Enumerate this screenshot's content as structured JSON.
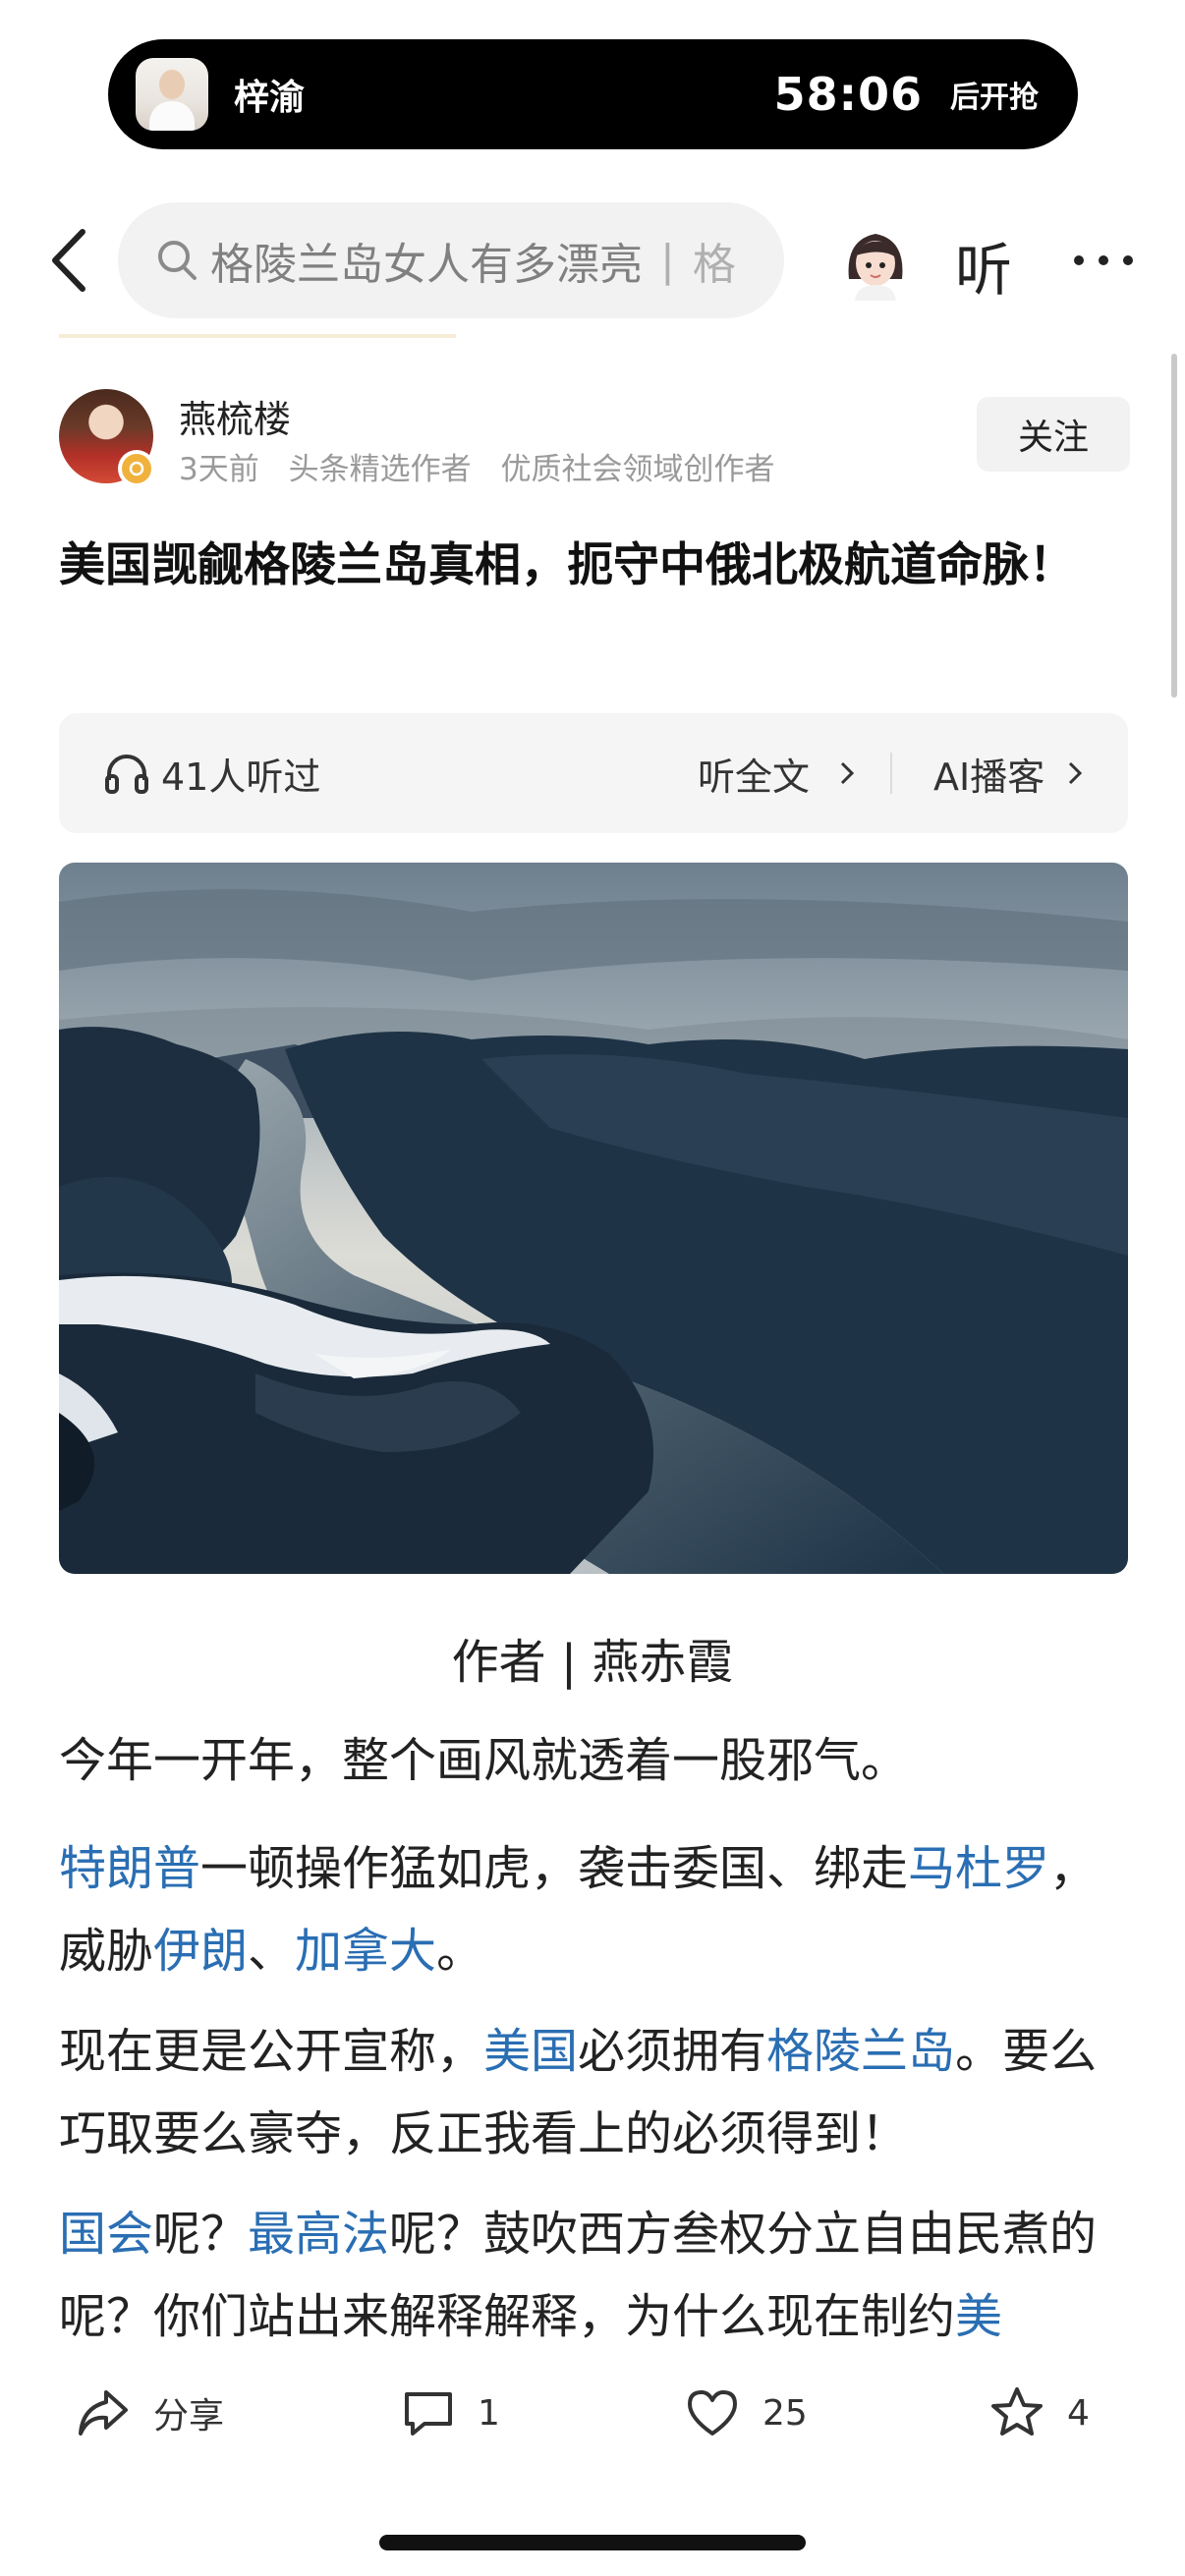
{
  "live_activity": {
    "name": "梓渝",
    "timer": "58:06",
    "label": "后开抢"
  },
  "header": {
    "search_placeholder": "格陵兰岛女人有多漂亮",
    "search_separator": "|",
    "search_next": "格",
    "listen_label": "听",
    "more_label": "···"
  },
  "author": {
    "name": "燕梳楼",
    "time": "3天前",
    "tags": [
      "头条精选作者",
      "优质社会领域创作者"
    ],
    "follow_label": "关注"
  },
  "article": {
    "title": "美国觊觎格陵兰岛真相，扼守中俄北极航道命脉！",
    "listen_count": "41人听过",
    "listen_full": "听全文",
    "ai_podcast": "AI播客",
    "byline": "作者 | 燕赤霞",
    "p1": "今年一开年，整个画风就透着一股邪气。",
    "p2": {
      "link_trump": "特朗普",
      "t1": "一顿操作猛如虎，袭击委国、绑走",
      "link_maduro": "马杜罗",
      "t2": "，威胁",
      "link_iran": "伊朗",
      "t3": "、",
      "link_canada": "加拿大",
      "t4": "。"
    },
    "p3": {
      "t1": "现在更是公开宣称，",
      "link_us": "美国",
      "t2": "必须拥有",
      "link_greenland": "格陵兰岛",
      "t3": "。要么巧取要么豪夺，反正我看上的必须得到！"
    },
    "p4": {
      "link_congress": "国会",
      "t1": "呢？",
      "link_court": "最高法",
      "t2": "呢？鼓吹西方叁权分立自由民煮的呢？你们站出来解释解释，为什么现在制约",
      "link_us": "美"
    }
  },
  "actions": {
    "share_label": "分享",
    "comment_count": "1",
    "like_count": "25",
    "favorite_count": "4"
  },
  "colors": {
    "link": "#2a6eb3",
    "text": "#222222",
    "muted": "#9a9a9a"
  }
}
